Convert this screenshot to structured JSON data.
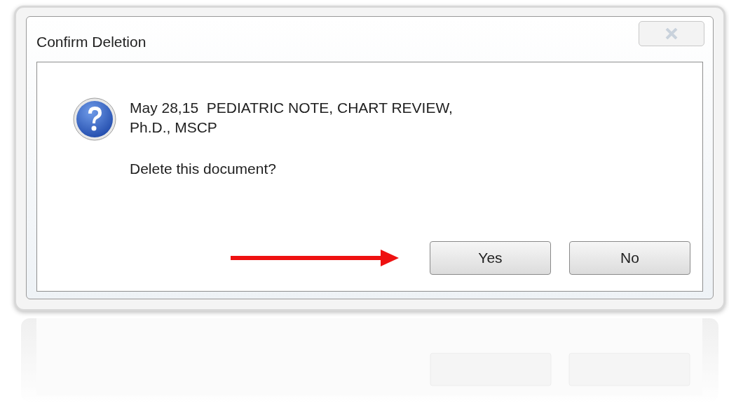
{
  "dialog": {
    "title": "Confirm Deletion",
    "message_lines": [
      "May 28,15  PEDIATRIC NOTE, CHART REVIEW,",
      "Ph.D., MSCP"
    ],
    "question": "Delete this document?",
    "buttons": [
      "Yes",
      "No"
    ]
  }
}
